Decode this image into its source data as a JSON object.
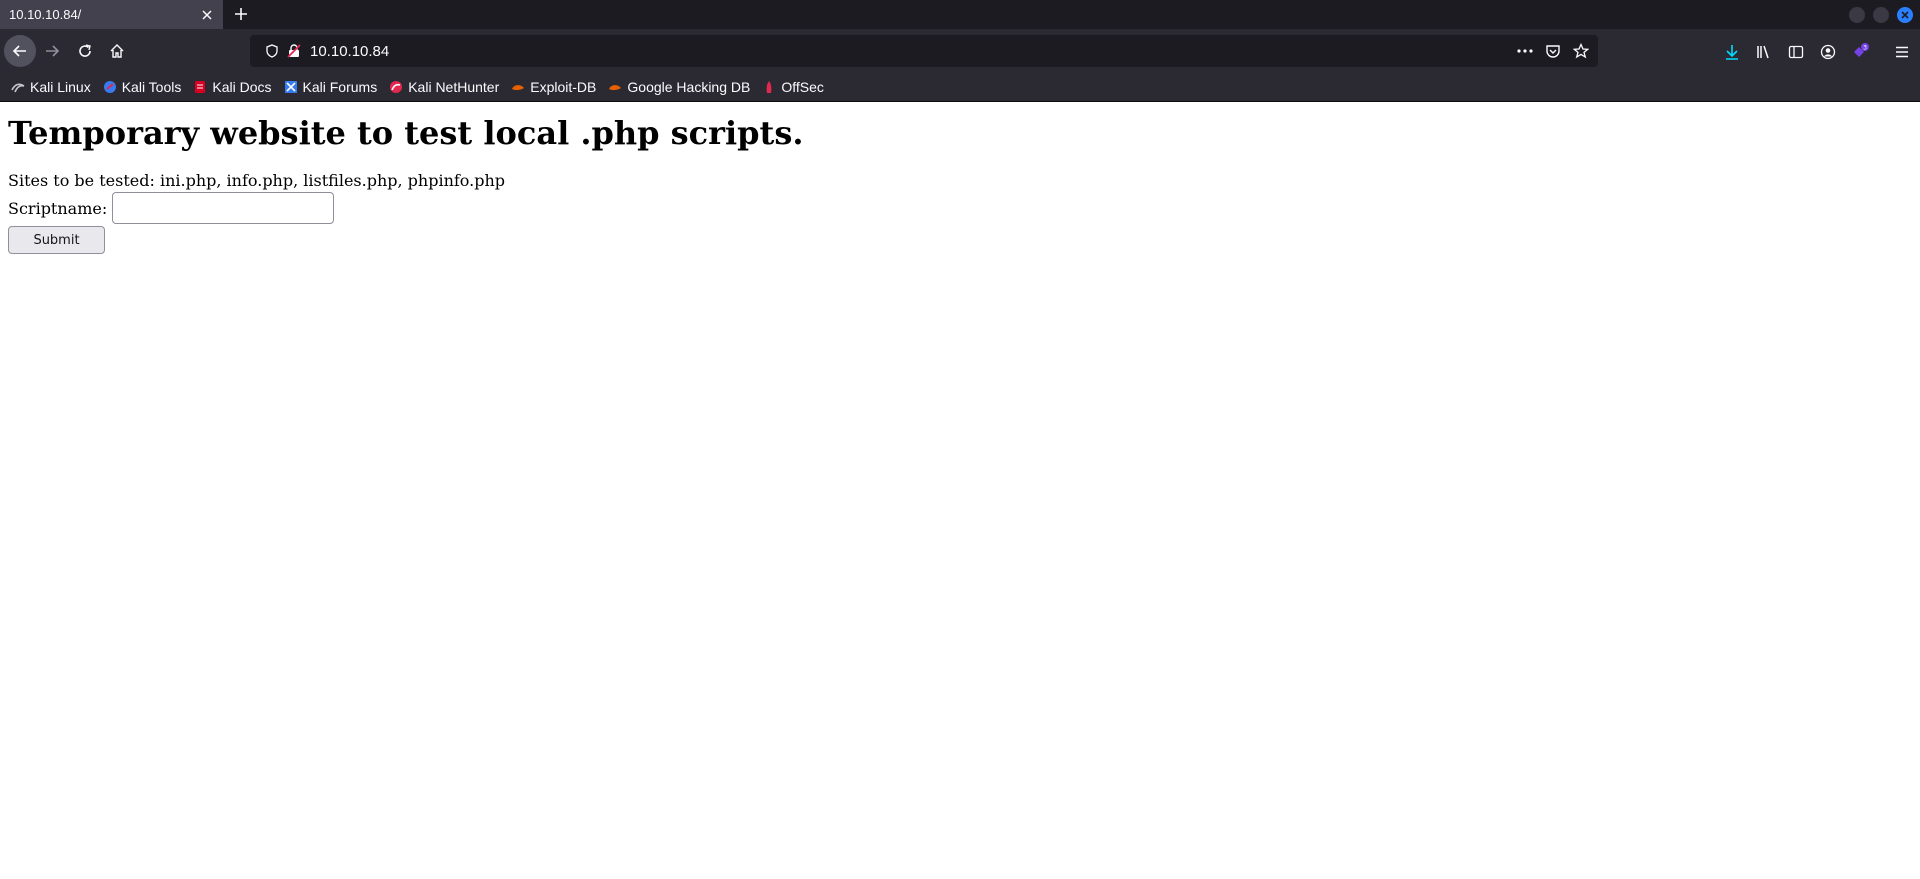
{
  "browser": {
    "tab": {
      "title": "10.10.10.84/"
    },
    "url": "10.10.10.84",
    "download_badge_color": "#0060df",
    "extension_badge": "3",
    "bookmarks": [
      {
        "label": "Kali Linux",
        "icon": "kali-dragon-icon"
      },
      {
        "label": "Kali Tools",
        "icon": "kali-tools-icon"
      },
      {
        "label": "Kali Docs",
        "icon": "kali-docs-icon"
      },
      {
        "label": "Kali Forums",
        "icon": "kali-forums-icon"
      },
      {
        "label": "Kali NetHunter",
        "icon": "kali-nethunter-icon"
      },
      {
        "label": "Exploit-DB",
        "icon": "exploit-db-icon"
      },
      {
        "label": "Google Hacking DB",
        "icon": "ghdb-icon"
      },
      {
        "label": "OffSec",
        "icon": "offsec-icon"
      }
    ]
  },
  "page": {
    "title": "Temporary website to test local .php scripts.",
    "sites_line": "Sites to be tested: ini.php, info.php, listfiles.php, phpinfo.php",
    "form": {
      "label": "Scriptname:",
      "input_value": "",
      "submit_label": "Submit"
    }
  }
}
